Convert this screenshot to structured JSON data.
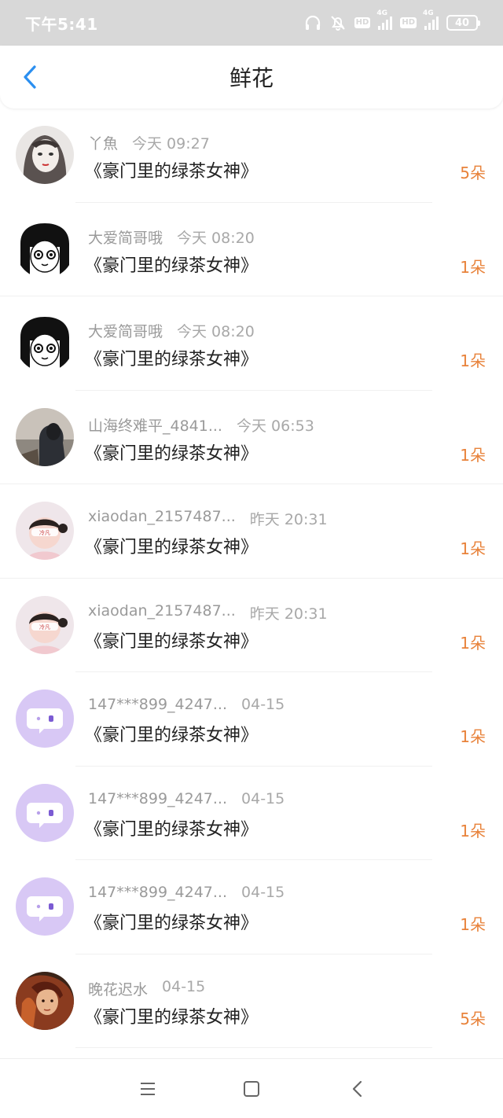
{
  "status_bar": {
    "time": "下午5:41",
    "hd1": "HD",
    "net1": "4G",
    "hd2": "HD",
    "net2": "4G",
    "battery": "40"
  },
  "header": {
    "title": "鲜花",
    "back_icon": "chevron-left-icon",
    "accent_color": "#2b8ff0"
  },
  "colors": {
    "count": "#e8823a",
    "placeholder_avatar": "#d8c8f5"
  },
  "items": [
    {
      "user": "丫魚",
      "time": "今天 09:27",
      "book": "《豪门里的绿茶女神》",
      "count": "5朵",
      "avatar": "girl-sketch-avatar"
    },
    {
      "user": "大爱简哥哦",
      "time": "今天 08:20",
      "book": "《豪门里的绿茶女神》",
      "count": "1朵",
      "avatar": "manga-girl-avatar"
    },
    {
      "user": "大爱简哥哦",
      "time": "今天 08:20",
      "book": "《豪门里的绿茶女神》",
      "count": "1朵",
      "avatar": "manga-girl-avatar"
    },
    {
      "user": "山海终难平_4841...",
      "time": "今天 06:53",
      "book": "《豪门里的绿茶女神》",
      "count": "1朵",
      "avatar": "photo-avatar"
    },
    {
      "user": "xiaodan_2157487...",
      "time": "昨天 20:31",
      "book": "《豪门里的绿茶女神》",
      "count": "1朵",
      "avatar": "baby-photo-avatar"
    },
    {
      "user": "xiaodan_2157487...",
      "time": "昨天 20:31",
      "book": "《豪门里的绿茶女神》",
      "count": "1朵",
      "avatar": "baby-photo-avatar"
    },
    {
      "user": "147***899_4247...",
      "time": "04-15",
      "book": "《豪门里的绿茶女神》",
      "count": "1朵",
      "avatar": "default-chat-avatar"
    },
    {
      "user": "147***899_4247...",
      "time": "04-15",
      "book": "《豪门里的绿茶女神》",
      "count": "1朵",
      "avatar": "default-chat-avatar"
    },
    {
      "user": "147***899_4247...",
      "time": "04-15",
      "book": "《豪门里的绿茶女神》",
      "count": "1朵",
      "avatar": "default-chat-avatar"
    },
    {
      "user": "晚花迟水",
      "time": "04-15",
      "book": "《豪门里的绿茶女神》",
      "count": "5朵",
      "avatar": "illustration-avatar"
    }
  ],
  "nav": {
    "menu_icon": "menu-icon",
    "home_icon": "home-square-icon",
    "back_icon": "back-triangle-icon"
  }
}
